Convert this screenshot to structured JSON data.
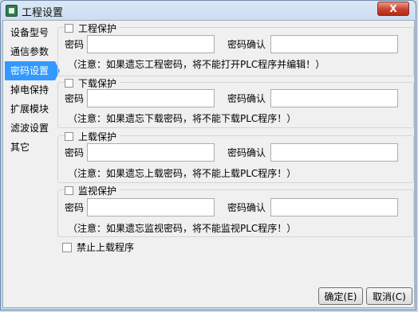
{
  "window": {
    "title": "工程设置",
    "close_symbol": "X",
    "app_icon": "app-settings-icon"
  },
  "sidebar": {
    "items": [
      {
        "label": "设备型号",
        "active": false
      },
      {
        "label": "通信参数",
        "active": false
      },
      {
        "label": "密码设置",
        "active": true
      },
      {
        "label": "掉电保持",
        "active": false
      },
      {
        "label": "扩展模块",
        "active": false
      },
      {
        "label": "滤波设置",
        "active": false
      },
      {
        "label": "其它",
        "active": false
      }
    ]
  },
  "groups": [
    {
      "title": "工程保护",
      "password_label": "密码",
      "confirm_label": "密码确认",
      "password_value": "",
      "confirm_value": "",
      "note": "（注意：如果遗忘工程密码，将不能打开PLC程序并编辑！）"
    },
    {
      "title": "下载保护",
      "password_label": "密码",
      "confirm_label": "密码确认",
      "password_value": "",
      "confirm_value": "",
      "note": "（注意：如果遗忘下载密码，将不能下载PLC程序！）"
    },
    {
      "title": "上载保护",
      "password_label": "密码",
      "confirm_label": "密码确认",
      "password_value": "",
      "confirm_value": "",
      "note": "（注意：如果遗忘上载密码，将不能上载PLC程序！）"
    },
    {
      "title": "监视保护",
      "password_label": "密码",
      "confirm_label": "密码确认",
      "password_value": "",
      "confirm_value": "",
      "note": "（注意：如果遗忘监视密码，将不能监视PLC程序！）"
    }
  ],
  "forbid_upload": {
    "label": "禁止上载程序",
    "checked": false
  },
  "buttons": {
    "ok": "确定(E)",
    "cancel": "取消(C)"
  }
}
